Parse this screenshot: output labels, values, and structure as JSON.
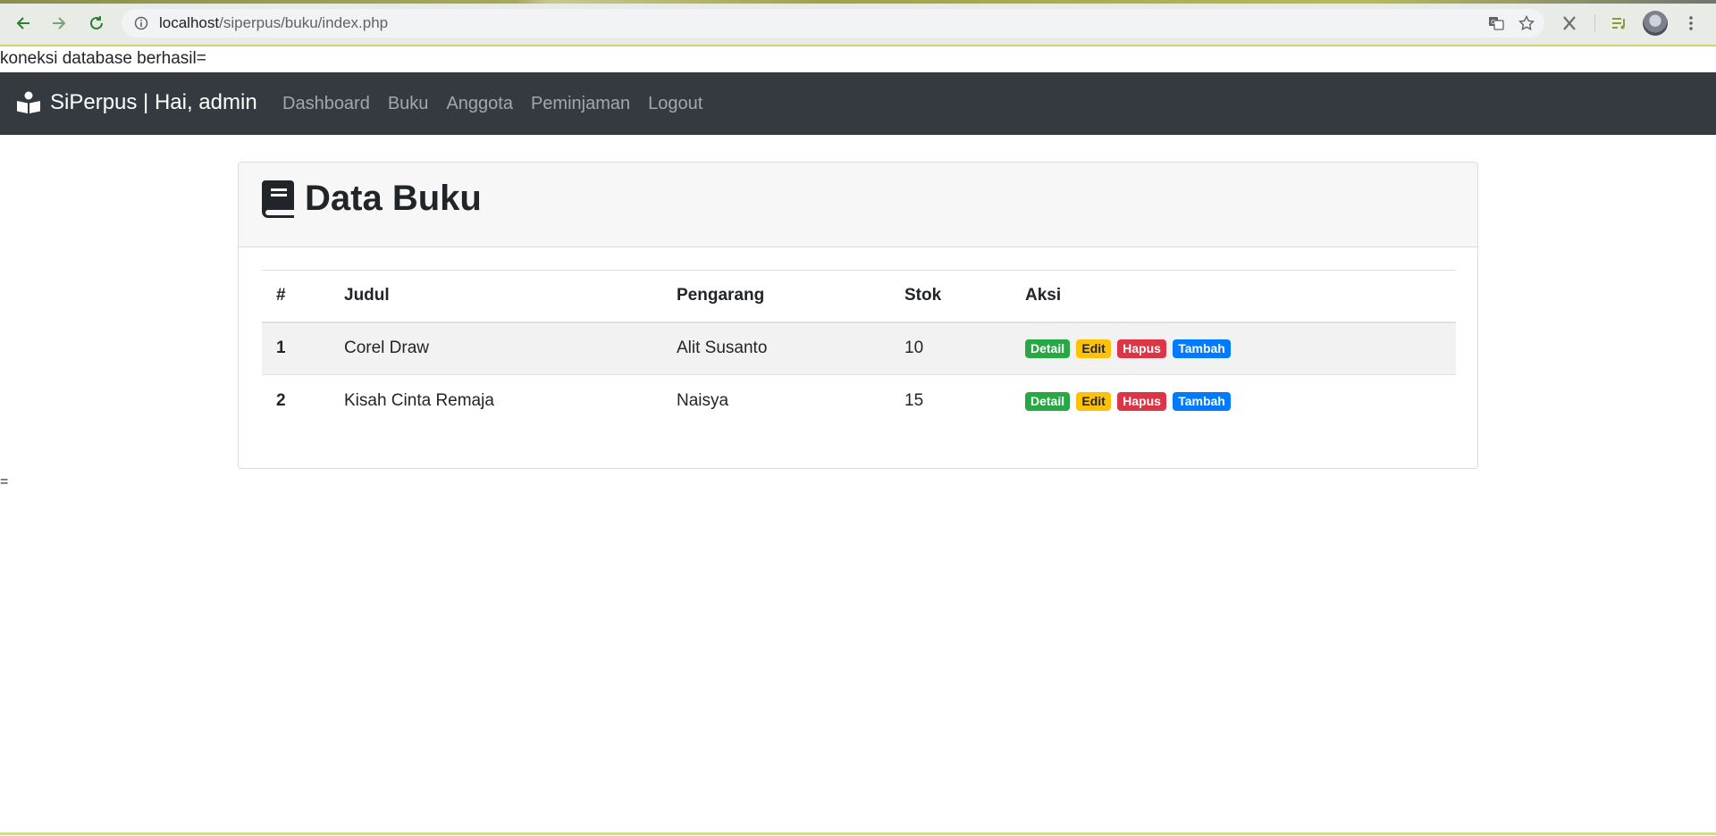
{
  "browser": {
    "url_host": "localhost",
    "url_path": "/siperpus/buku/index.php"
  },
  "debug_text": "koneksi database berhasil=",
  "navbar": {
    "brand": "SiPerpus | Hai, admin",
    "links": [
      "Dashboard",
      "Buku",
      "Anggota",
      "Peminjaman",
      "Logout"
    ]
  },
  "card": {
    "title": "Data Buku",
    "headers": [
      "#",
      "Judul",
      "Pengarang",
      "Stok",
      "Aksi"
    ],
    "rows": [
      {
        "num": "1",
        "judul": "Corel Draw",
        "pengarang": "Alit Susanto",
        "stok": "10"
      },
      {
        "num": "2",
        "judul": "Kisah Cinta Remaja",
        "pengarang": "Naisya",
        "stok": "15"
      }
    ],
    "actions": {
      "detail": "Detail",
      "edit": "Edit",
      "hapus": "Hapus",
      "tambah": "Tambah"
    }
  },
  "trailing_text": "=",
  "colors": {
    "navbar_bg": "#343a40",
    "detail": "#28a745",
    "edit": "#ffc107",
    "hapus": "#dc3545",
    "tambah": "#007bff"
  }
}
